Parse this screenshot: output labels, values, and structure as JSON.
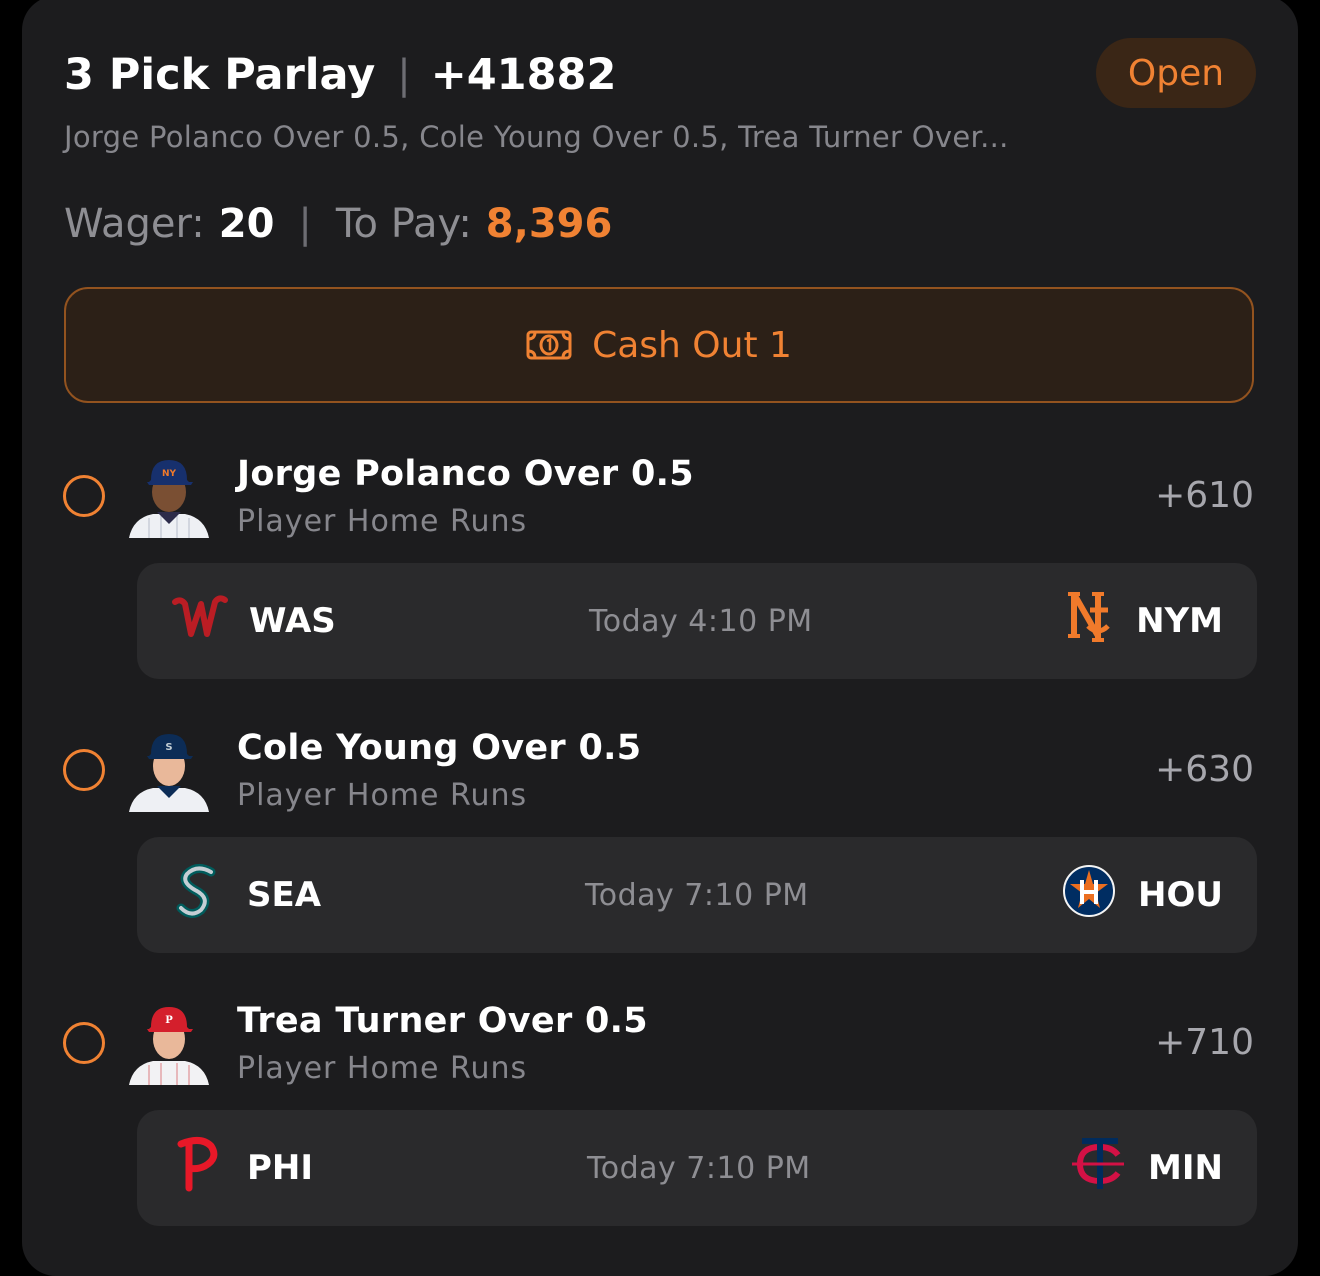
{
  "header": {
    "title": "3 Pick Parlay",
    "separator": "|",
    "odds": "+41882",
    "status": "Open",
    "summary": "Jorge Polanco Over 0.5, Cole Young Over 0.5, Trea Turner Over..."
  },
  "wager": {
    "wager_label": "Wager:",
    "wager_value": "20",
    "separator": "|",
    "pay_label": "To Pay:",
    "pay_value": "8,396"
  },
  "cashout": {
    "label": "Cash Out 1",
    "icon": "money-bill-icon"
  },
  "legs": [
    {
      "pick": "Jorge Polanco Over 0.5",
      "market": "Player Home Runs",
      "odds": "+610",
      "away": "WAS",
      "home": "NYM",
      "time": "Today 4:10 PM"
    },
    {
      "pick": "Cole Young Over 0.5",
      "market": "Player Home Runs",
      "odds": "+630",
      "away": "SEA",
      "home": "HOU",
      "time": "Today 7:10 PM"
    },
    {
      "pick": "Trea Turner Over 0.5",
      "market": "Player Home Runs",
      "odds": "+710",
      "away": "PHI",
      "home": "MIN",
      "time": "Today 7:10 PM"
    }
  ],
  "colors": {
    "accent": "#f08233",
    "card": "#1c1c1e",
    "game_box": "#2a2a2c",
    "muted": "#86868c"
  }
}
